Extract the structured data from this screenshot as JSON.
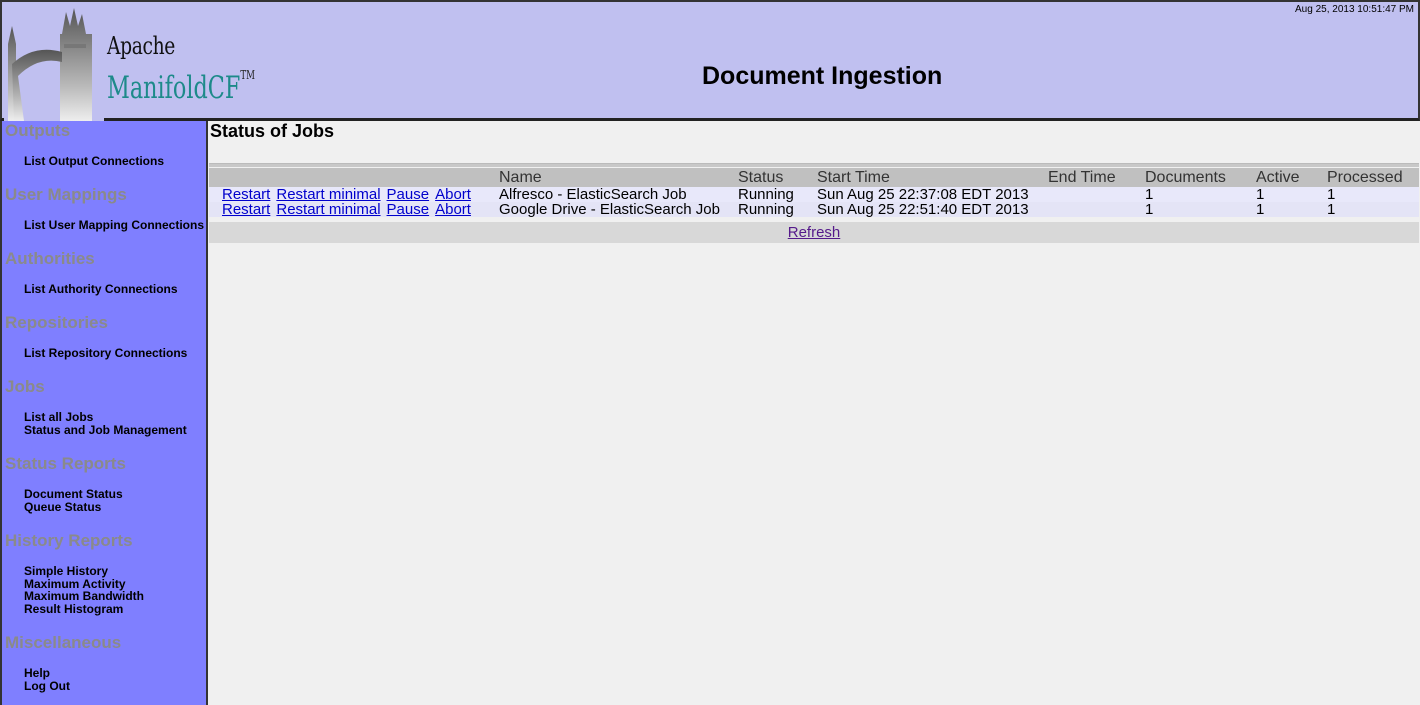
{
  "header": {
    "timestamp": "Aug 25, 2013 10:51:47 PM",
    "logo_top": "Apache",
    "logo_bottom": "ManifoldCF",
    "logo_tm": "TM",
    "page_heading": "Document Ingestion"
  },
  "sidebar": {
    "sections": [
      {
        "title": "Outputs",
        "links": [
          "List Output Connections"
        ]
      },
      {
        "title": "User Mappings",
        "links": [
          "List User Mapping Connections"
        ]
      },
      {
        "title": "Authorities",
        "links": [
          "List Authority Connections"
        ]
      },
      {
        "title": "Repositories",
        "links": [
          "List Repository Connections"
        ]
      },
      {
        "title": "Jobs",
        "links": [
          "List all Jobs",
          "Status and Job Management"
        ]
      },
      {
        "title": "Status Reports",
        "links": [
          "Document Status",
          "Queue Status"
        ]
      },
      {
        "title": "History Reports",
        "links": [
          "Simple History",
          "Maximum Activity",
          "Maximum Bandwidth",
          "Result Histogram"
        ]
      },
      {
        "title": "Miscellaneous",
        "links": [
          "Help",
          "Log Out"
        ]
      }
    ]
  },
  "main": {
    "title": "Status of Jobs",
    "columns": [
      "",
      "Name",
      "Status",
      "Start Time",
      "End Time",
      "Documents",
      "Active",
      "Processed"
    ],
    "jobs": [
      {
        "actions": [
          "Restart",
          "Restart minimal",
          "Pause",
          "Abort"
        ],
        "name": "Alfresco - ElasticSearch Job",
        "status": "Running",
        "start_time": "Sun Aug 25 22:37:08 EDT 2013",
        "end_time": "",
        "documents": "1",
        "active": "1",
        "processed": "1"
      },
      {
        "actions": [
          "Restart",
          "Restart minimal",
          "Pause",
          "Abort"
        ],
        "name": "Google Drive - ElasticSearch Job",
        "status": "Running",
        "start_time": "Sun Aug 25 22:51:40 EDT 2013",
        "end_time": "",
        "documents": "1",
        "active": "1",
        "processed": "1"
      }
    ],
    "refresh_label": "Refresh"
  }
}
